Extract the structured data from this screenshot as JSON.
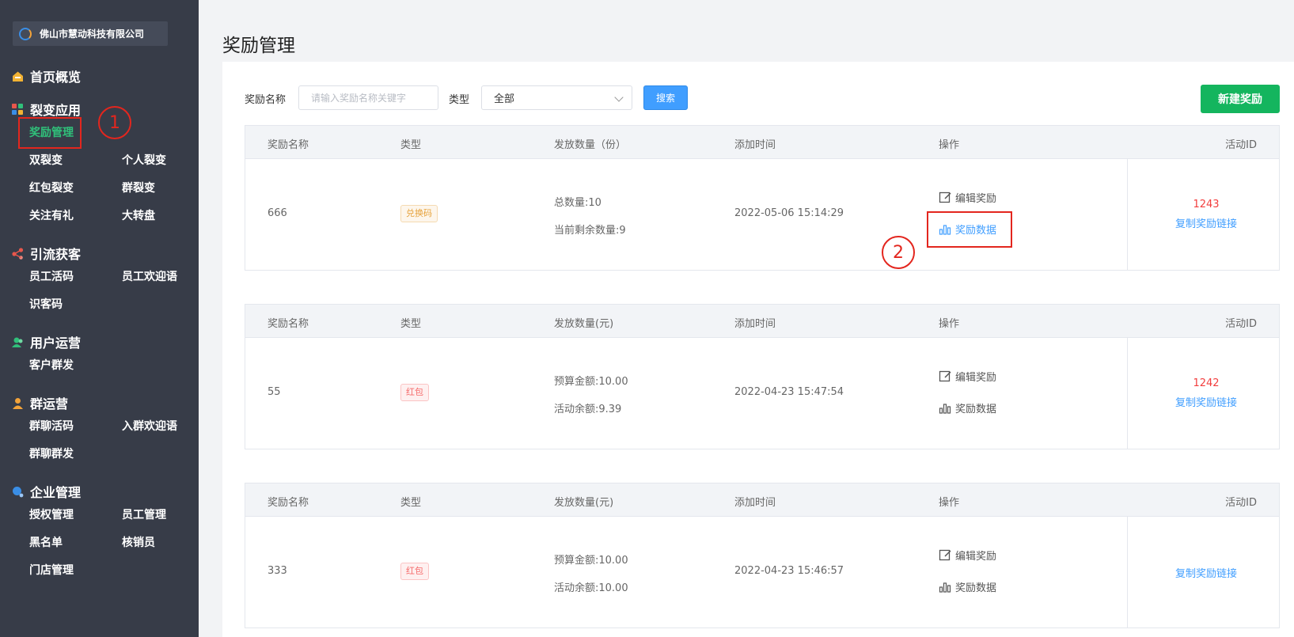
{
  "company": {
    "name": "佛山市慧动科技有限公司"
  },
  "sidebar": {
    "sections": [
      {
        "label": "首页概览",
        "icon": "home-icon",
        "color": "#f2b233"
      },
      {
        "label": "裂变应用",
        "icon": "apps-icon",
        "color": "#e8574c"
      },
      {
        "label": "引流获客",
        "icon": "share-icon",
        "color": "#e8574c"
      },
      {
        "label": "用户运营",
        "icon": "users-icon",
        "color": "#30c07a"
      },
      {
        "label": "群运营",
        "icon": "group-icon",
        "color": "#f2a33a"
      },
      {
        "label": "企业管理",
        "icon": "enterprise-icon",
        "color": "#3a8ee6"
      }
    ],
    "items": {
      "reward_mgmt": "奖励管理",
      "double_fission": "双裂变",
      "personal_fission": "个人裂变",
      "redpack_fission": "红包裂变",
      "group_fission": "群裂变",
      "follow_gift": "关注有礼",
      "wheel": "大转盘",
      "staff_code": "员工活码",
      "staff_welcome": "员工欢迎语",
      "visitor_code": "识客码",
      "customer_mass": "客户群发",
      "group_code": "群聊活码",
      "group_welcome": "入群欢迎语",
      "group_mass": "群聊群发",
      "auth_mgmt": "授权管理",
      "staff_mgmt": "员工管理",
      "blacklist": "黑名单",
      "verifier": "核销员",
      "store_mgmt": "门店管理"
    }
  },
  "annotations": {
    "one": "1",
    "two": "2"
  },
  "page": {
    "title": "奖励管理"
  },
  "filters": {
    "name_label": "奖励名称",
    "name_placeholder": "请输入奖励名称关键字",
    "type_label": "类型",
    "type_value": "全部",
    "search_button": "搜索",
    "new_button": "新建奖励"
  },
  "table_headers": {
    "name": "奖励名称",
    "type": "类型",
    "qty_share": "发放数量（份）",
    "qty_yuan": "发放数量(元)",
    "time": "添加时间",
    "ops": "操作",
    "activity_id": "活动ID"
  },
  "rows": [
    {
      "name": "666",
      "type": "兑换码",
      "line1": "总数量:10",
      "line2": "当前剩余数量:9",
      "time": "2022-05-06 15:14:29",
      "edit": "编辑奖励",
      "data": "奖励数据",
      "activity_id": "1243",
      "copy_link": "复制奖励链接"
    },
    {
      "name": "55",
      "type": "红包",
      "line1": "预算金额:10.00",
      "line2": "活动余额:9.39",
      "time": "2022-04-23 15:47:54",
      "edit": "编辑奖励",
      "data": "奖励数据",
      "activity_id": "1242",
      "copy_link": "复制奖励链接"
    },
    {
      "name": "333",
      "type": "红包",
      "line1": "预算金额:10.00",
      "line2": "活动余额:10.00",
      "time": "2022-04-23 15:46:57",
      "edit": "编辑奖励",
      "data": "奖励数据",
      "activity_id": "",
      "copy_link": "复制奖励链接"
    }
  ]
}
